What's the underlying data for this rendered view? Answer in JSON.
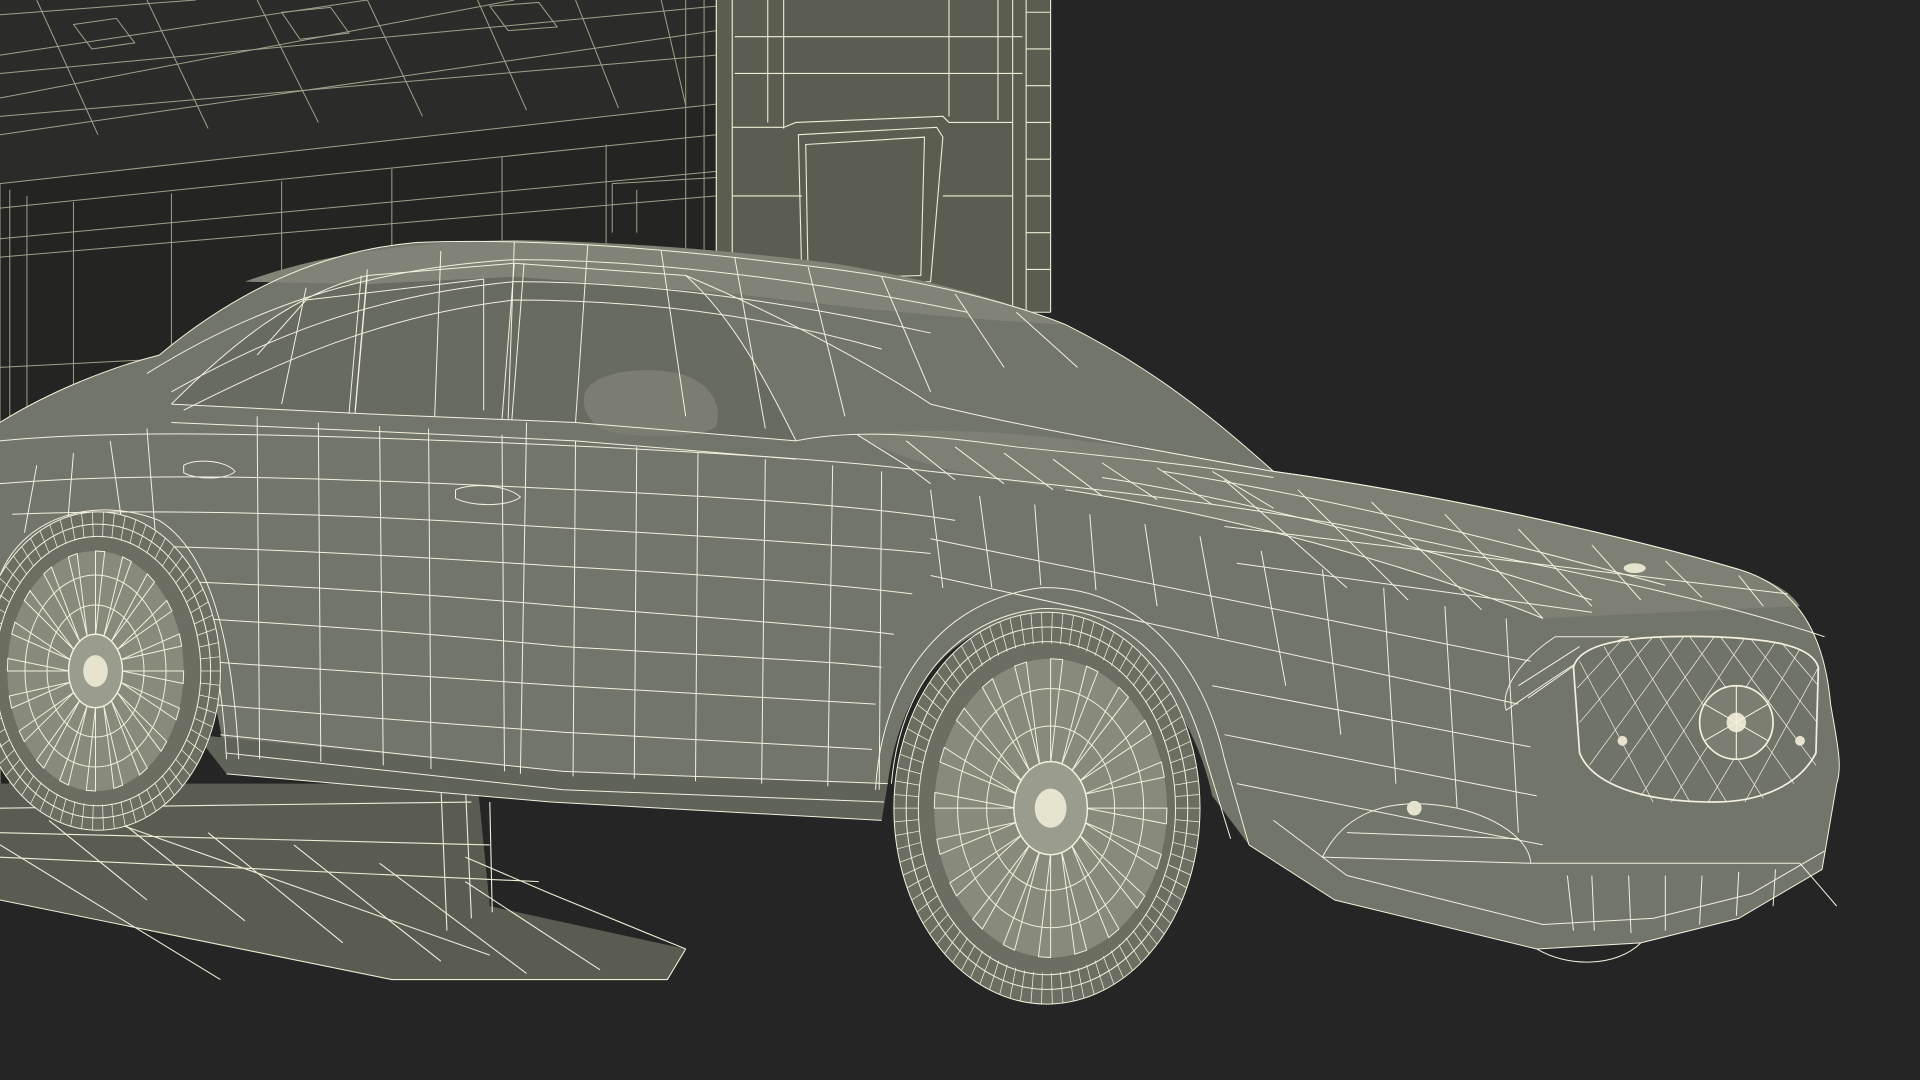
{
  "scene": {
    "subject": "sedan-wireframe-in-garage",
    "render_style": "wireframe"
  },
  "colors": {
    "background": "#252525",
    "garage_fill": "#2f302d",
    "garage_dark": "#1e1f1d",
    "garage_wire": "#b7b79c",
    "pillar_fill": "#5e5f52",
    "ramp_fill": "#5d5e52",
    "car_body": "#74776a",
    "car_body_shadow": "#5f6257",
    "car_highlight": "#858879",
    "glass": "#666a5f",
    "wire": "#f2f0dc",
    "tire": "#6c6e62",
    "rim": "#8b8d7f",
    "grille": "#6f7166"
  },
  "icons": {
    "wheel_front": "wheel-icon",
    "wheel_rear": "wheel-icon",
    "grille": "grille-icon",
    "mirror": "mirror-icon"
  }
}
